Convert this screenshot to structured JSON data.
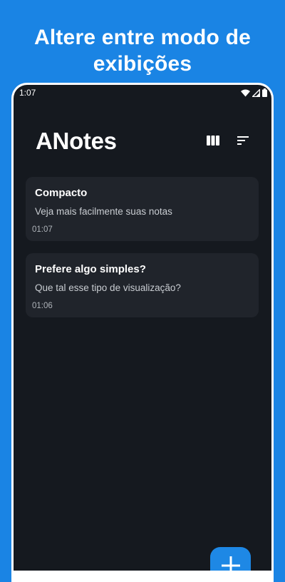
{
  "promo": {
    "headline_line1": "Altere entre modo de",
    "headline_line2": "exibições"
  },
  "status_bar": {
    "time": "1:07",
    "icons": [
      "wifi-icon",
      "cellular-signal-icon",
      "battery-icon"
    ]
  },
  "app": {
    "title": "ANotes",
    "toolbar_icons": [
      "view-mode-icon",
      "sort-icon"
    ]
  },
  "notes": [
    {
      "title": "Compacto",
      "body": "Veja mais facilmente suas notas",
      "time": "01:07"
    },
    {
      "title": "Prefere algo simples?",
      "body": "Que tal esse tipo de visualização?",
      "time": "01:06"
    }
  ],
  "fab": {
    "icon": "plus-icon"
  },
  "colors": {
    "promo_background": "#1A84E4",
    "screen_background": "#15191F",
    "card_background": "#20242B",
    "fab_background": "#1E88E5"
  }
}
